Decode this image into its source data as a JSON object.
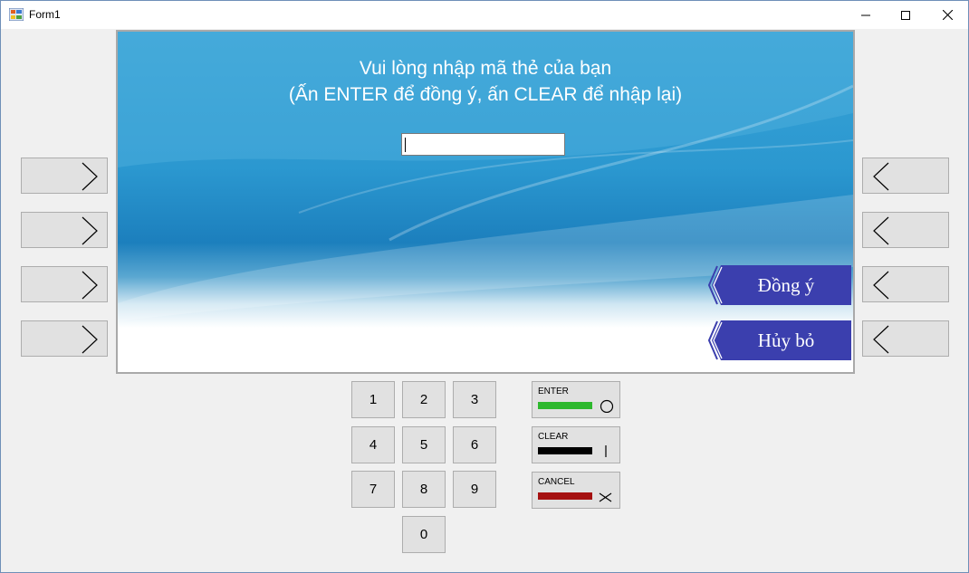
{
  "window": {
    "title": "Form1"
  },
  "screen": {
    "prompt_line1": "Vui lòng nhập mã thẻ của bạn",
    "prompt_line2": "(Ấn ENTER để đồng ý, ấn CLEAR để nhập lại)",
    "card_input_value": "",
    "options": [
      {
        "label": "Đồng ý"
      },
      {
        "label": "Hủy bỏ"
      }
    ]
  },
  "side_buttons": {
    "left": [
      "chevron-right-icon",
      "chevron-right-icon",
      "chevron-right-icon",
      "chevron-right-icon"
    ],
    "right": [
      "chevron-left-icon",
      "chevron-left-icon",
      "chevron-left-icon",
      "chevron-left-icon"
    ]
  },
  "keypad": {
    "keys": [
      "1",
      "2",
      "3",
      "4",
      "5",
      "6",
      "7",
      "8",
      "9",
      "0"
    ]
  },
  "function_keys": {
    "enter": {
      "label": "ENTER",
      "color": "#2db82d",
      "icon": "circle-icon"
    },
    "clear": {
      "label": "CLEAR",
      "color": "#000000",
      "icon": "vertical-bar-icon"
    },
    "cancel": {
      "label": "CANCEL",
      "color": "#a51111",
      "icon": "x-icon"
    }
  },
  "colors": {
    "option_button": "#3b3fae",
    "screen_border": "#a9a9a9"
  }
}
